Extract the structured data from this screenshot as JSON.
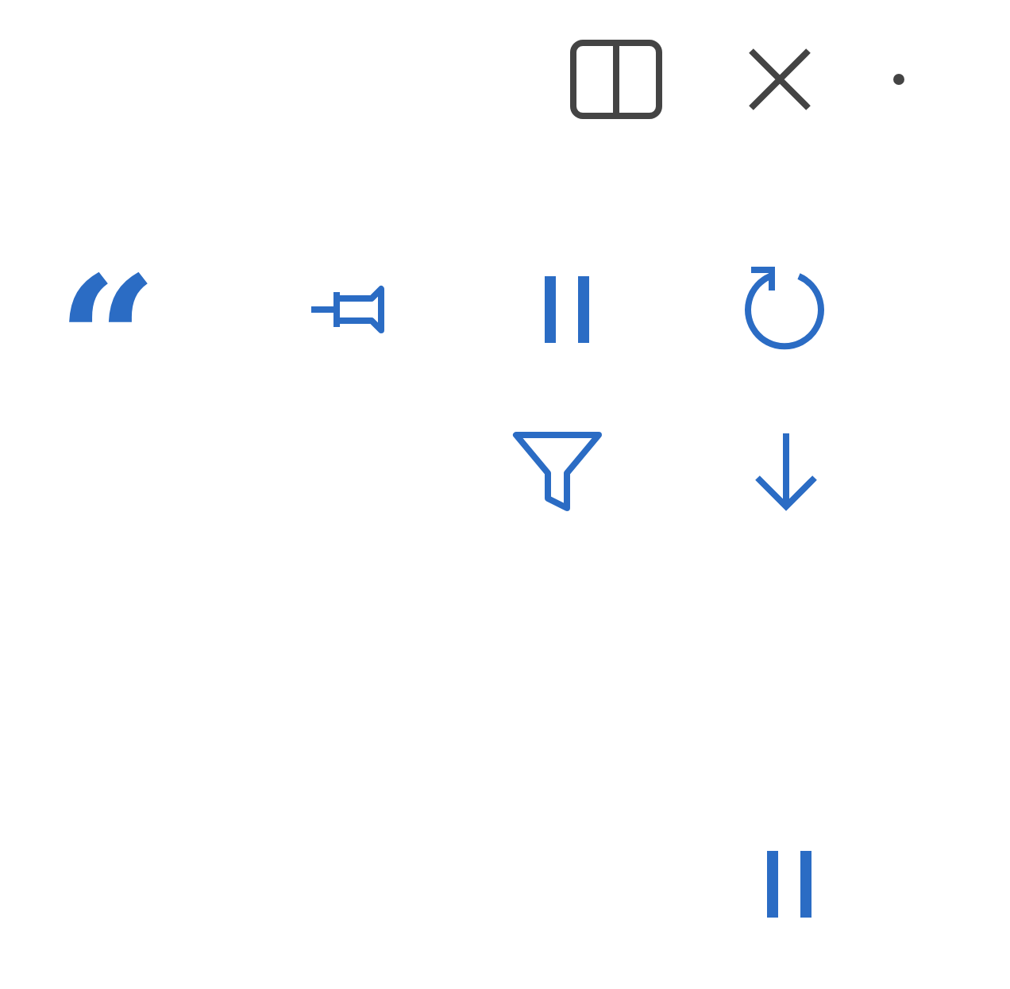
{
  "toolbar": {
    "quote_glyph": "“"
  }
}
